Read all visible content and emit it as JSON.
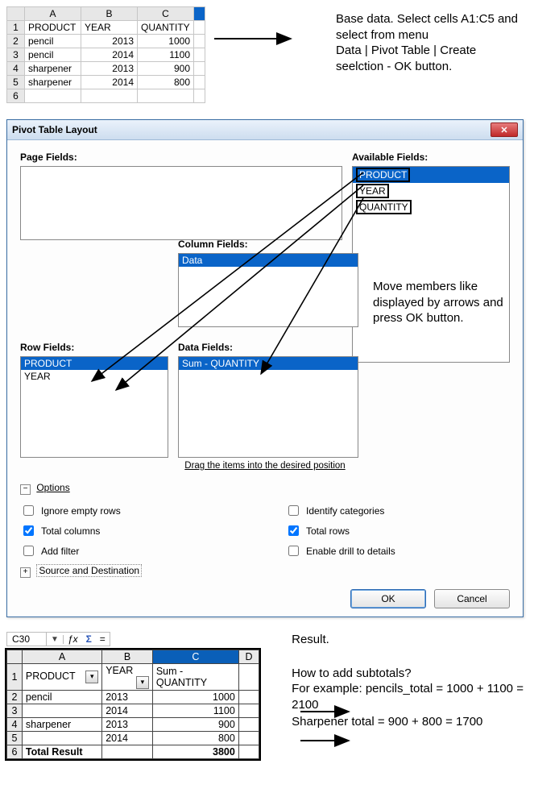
{
  "sheet1": {
    "cols": [
      "A",
      "B",
      "C"
    ],
    "headers": {
      "a": "PRODUCT",
      "b": "YEAR",
      "c": "QUANTITY"
    },
    "rows": [
      {
        "n": "1",
        "a": "PRODUCT",
        "b": "YEAR",
        "c": "QUANTITY"
      },
      {
        "n": "2",
        "a": "pencil",
        "b": "2013",
        "c": "1000"
      },
      {
        "n": "3",
        "a": "pencil",
        "b": "2014",
        "c": "1100"
      },
      {
        "n": "4",
        "a": "sharpener",
        "b": "2013",
        "c": "900"
      },
      {
        "n": "5",
        "a": "sharpener",
        "b": "2014",
        "c": "800"
      },
      {
        "n": "6",
        "a": "",
        "b": "",
        "c": ""
      }
    ]
  },
  "note1": "Base data. Select cells A1:C5 and select from menu\nData | Pivot Table | Create seelction -  OK button.",
  "dialog": {
    "title": "Pivot Table Layout",
    "labels": {
      "page": "Page Fields:",
      "avail": "Available Fields:",
      "col": "Column Fields:",
      "row": "Row Fields:",
      "data": "Data Fields:",
      "drag": "Drag the items into the desired position"
    },
    "avail": [
      "PRODUCT",
      "YEAR",
      "QUANTITY"
    ],
    "colf": [
      "Data"
    ],
    "rowf": [
      "PRODUCT",
      "YEAR"
    ],
    "dataf": [
      "Sum - QUANTITY"
    ],
    "opts": {
      "title": "Options",
      "ignore": "Ignore empty rows",
      "total_cols": "Total columns",
      "addfilter": "Add filter",
      "identify": "Identify categories",
      "total_rows": "Total rows",
      "drill": "Enable drill to details",
      "srcdst": "Source and Destination"
    },
    "sidenote": "Move members like displayed by arrows and press OK button.",
    "ok": "OK",
    "cancel": "Cancel"
  },
  "formula": {
    "cell": "C30",
    "fx": "ƒx",
    "sum": "Σ",
    "eq": "="
  },
  "sheet2": {
    "cols": [
      "A",
      "B",
      "C"
    ],
    "extra": "D",
    "headers": {
      "a": "PRODUCT",
      "b": "YEAR",
      "c": "Sum - QUANTITY"
    },
    "r2": {
      "a": "pencil",
      "b": "2013",
      "c": "1000"
    },
    "r3": {
      "a": "",
      "b": "2014",
      "c": "1100"
    },
    "r4": {
      "a": "sharpener",
      "b": "2013",
      "c": "900"
    },
    "r5": {
      "a": "",
      "b": "2014",
      "c": "800"
    },
    "r6": {
      "a": "Total Result",
      "b": "",
      "c": "3800"
    }
  },
  "note2": "Result.",
  "note3": "How to add subtotals?\nFor example: pencils_total = 1000 + 1100 = 2100",
  "note4": "Sharpener total = 900 + 800 = 1700"
}
